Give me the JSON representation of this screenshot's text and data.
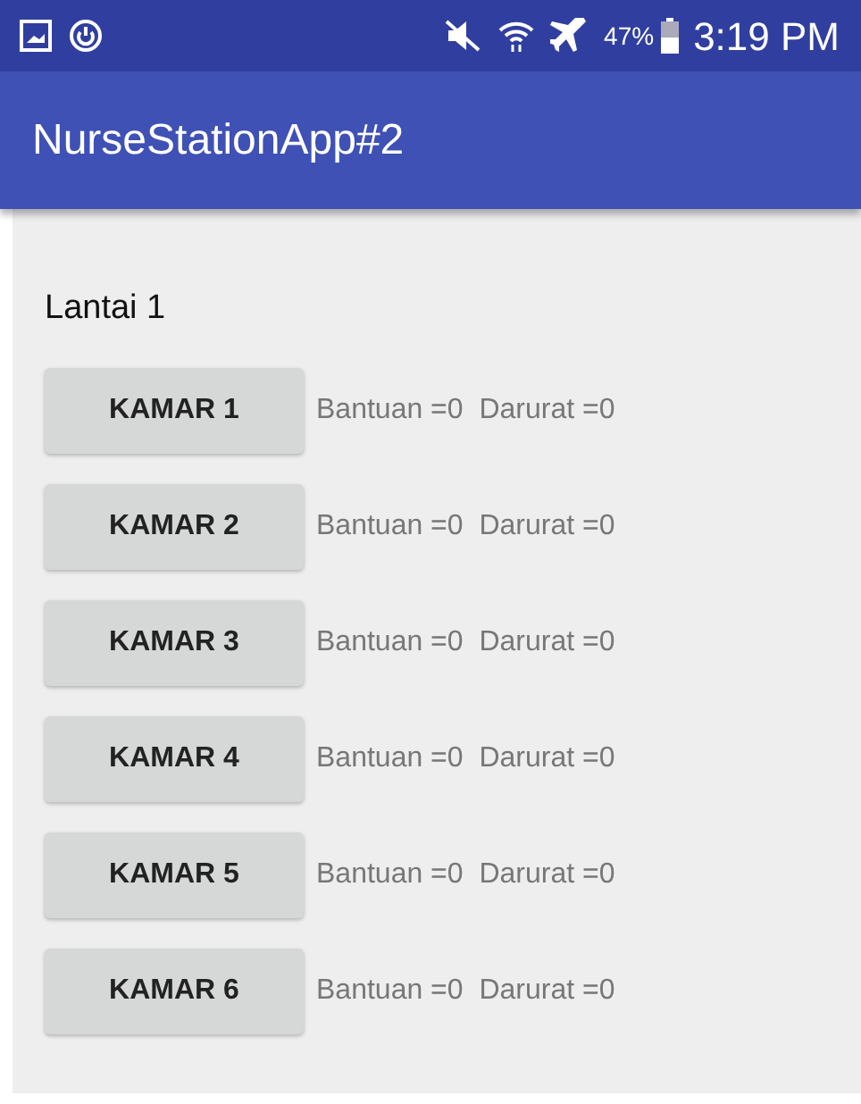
{
  "status_bar": {
    "battery": "47%",
    "time": "3:19 PM"
  },
  "app_bar": {
    "title": "NurseStationApp#2"
  },
  "floor_label": "Lantai 1",
  "rooms": [
    {
      "button": "KAMAR 1",
      "status": "Bantuan =0  Darurat =0"
    },
    {
      "button": "KAMAR 2",
      "status": "Bantuan =0  Darurat =0"
    },
    {
      "button": "KAMAR 3",
      "status": "Bantuan =0  Darurat =0"
    },
    {
      "button": "KAMAR 4",
      "status": "Bantuan =0  Darurat =0"
    },
    {
      "button": "KAMAR 5",
      "status": "Bantuan =0  Darurat =0"
    },
    {
      "button": "KAMAR 6",
      "status": "Bantuan =0  Darurat =0"
    }
  ]
}
